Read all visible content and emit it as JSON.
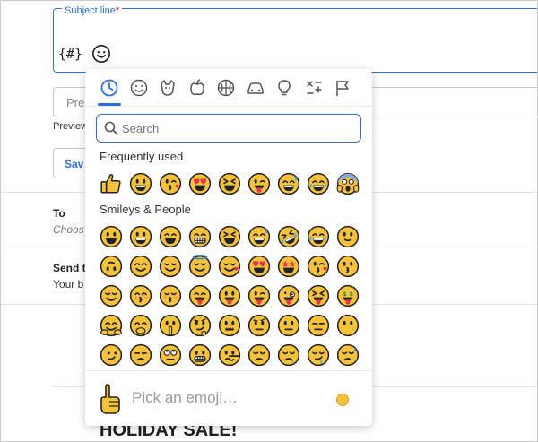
{
  "form": {
    "subject_label": "Subject line",
    "required_mark": "*",
    "merge_tag_label": "{#}",
    "preview_placeholder": "Pre",
    "preview_caption": "Preview",
    "save_label": "Sav",
    "to_label": "To",
    "to_sub": "Choos",
    "send_label": "Send t",
    "send_sub": "Your b",
    "holiday_text": "HOLIDAY SALE!"
  },
  "picker": {
    "categories": [
      "recent-icon",
      "smileys-icon",
      "animals-icon",
      "food-icon",
      "activity-icon",
      "travel-icon",
      "objects-icon",
      "symbols-icon",
      "flags-icon"
    ],
    "active_category": 0,
    "search_placeholder": "Search",
    "frequently_used_title": "Frequently used",
    "frequently_used": [
      "thumbs-up",
      "grinning",
      "wink-kiss",
      "heart-eyes",
      "squint-laugh",
      "tongue-wink",
      "sweat-smile",
      "joy",
      "scream"
    ],
    "smileys_title": "Smileys & People",
    "smileys": [
      "grinning-big",
      "grinning",
      "grin-smile",
      "beaming",
      "squint-laugh",
      "sweat-smile",
      "rofl",
      "joy",
      "slight-smile",
      "upside-down",
      "smile",
      "blush",
      "halo",
      "hearts",
      "heart-eyes",
      "star-struck",
      "kiss",
      "kissing",
      "relieved",
      "blush-kiss",
      "kissing-closed",
      "yum",
      "tongue",
      "tongue-wink",
      "zany",
      "tongue-squint",
      "money-mouth",
      "hugging",
      "hand-mouth",
      "shush",
      "thinking",
      "zipper",
      "raised-brow",
      "neutral",
      "expressionless",
      "no-mouth",
      "smirk",
      "unamused",
      "eye-roll",
      "grimace",
      "lying",
      "pensive",
      "sleepy",
      "drooling",
      "sweat"
    ],
    "footer_placeholder": "Pick an emoji…",
    "skin_tone_color": "#f6c23b"
  }
}
